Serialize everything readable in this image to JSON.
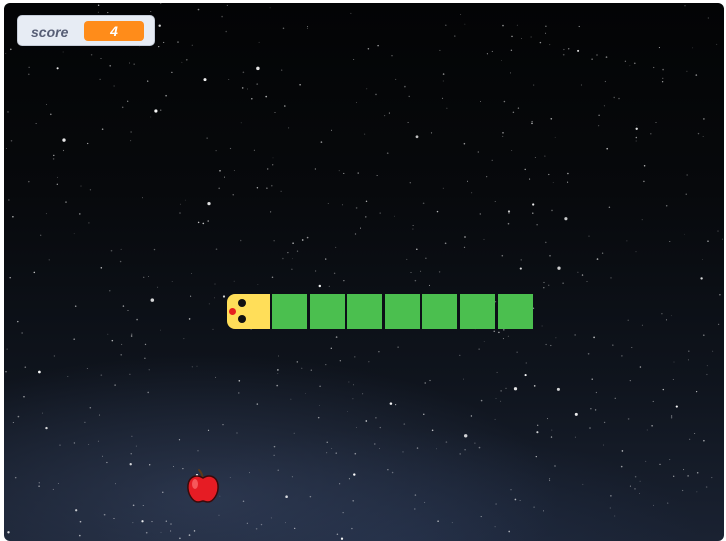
{
  "score_monitor": {
    "label": "score",
    "value": "4"
  },
  "snake": {
    "head_color": "#ffde59",
    "body_color": "#4bbf4f",
    "body_segments": 7,
    "direction": "left"
  },
  "apple": {
    "icon": "apple-icon",
    "color": "#e61c24"
  },
  "colors": {
    "score_value_bg": "#ff8c1a",
    "monitor_bg": "#e7ecf4",
    "background": "#07090c"
  }
}
